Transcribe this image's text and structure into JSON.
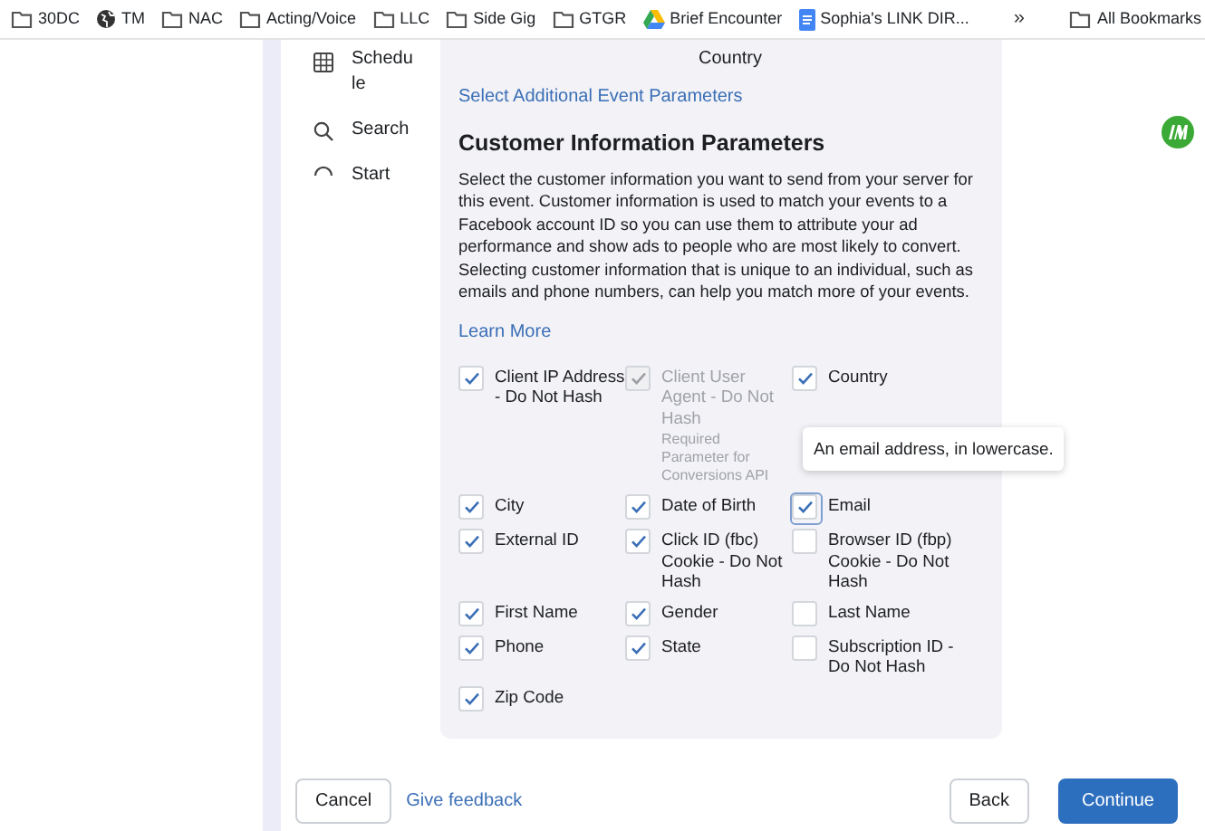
{
  "bookmarks": [
    {
      "label": "30DC",
      "kind": "folder"
    },
    {
      "label": "TM",
      "kind": "site"
    },
    {
      "label": "NAC",
      "kind": "folder"
    },
    {
      "label": "Acting/Voice",
      "kind": "folder"
    },
    {
      "label": "LLC",
      "kind": "folder"
    },
    {
      "label": "Side Gig",
      "kind": "folder"
    },
    {
      "label": "GTGR",
      "kind": "folder"
    },
    {
      "label": "Brief Encounter",
      "kind": "drive"
    },
    {
      "label": "Sophia's LINK DIR...",
      "kind": "doc"
    }
  ],
  "bookmarks_overflow": "»",
  "all_bookmarks": "All Bookmarks",
  "sidebar": {
    "items": [
      {
        "label": "Schedule"
      },
      {
        "label": "Search"
      },
      {
        "label": "Start"
      }
    ]
  },
  "previous_item": "Country",
  "additional_link": "Select Additional Event Parameters",
  "section": {
    "title": "Customer Information Parameters",
    "description": "Select the customer information you want to send from your server for this event. Customer information is used to match your events to a Facebook account ID so you can use them to attribute your ad performance and show ads to people who are most likely to convert. Selecting customer information that is unique to an individual, such as emails and phone numbers, can help you match more of your events.",
    "learn_more": "Learn More",
    "parameters": [
      {
        "label": "Client IP Address - Do Not Hash",
        "checked": true,
        "disabled": false
      },
      {
        "label": "Client User Agent - Do Not Hash",
        "note": "Required Parameter for Conversions API",
        "checked": true,
        "disabled": true
      },
      {
        "label": "Country",
        "checked": true,
        "disabled": false
      },
      {
        "label": "City",
        "checked": true,
        "disabled": false
      },
      {
        "label": "Date of Birth",
        "checked": true,
        "disabled": false
      },
      {
        "label": "Email",
        "checked": true,
        "disabled": false,
        "focused": true
      },
      {
        "label": "External ID",
        "checked": true,
        "disabled": false
      },
      {
        "label": "Click ID (fbc) Cookie - Do Not Hash",
        "checked": true,
        "disabled": false
      },
      {
        "label": "Browser ID (fbp) Cookie - Do Not Hash",
        "checked": false,
        "disabled": false
      },
      {
        "label": "First Name",
        "checked": true,
        "disabled": false
      },
      {
        "label": "Gender",
        "checked": true,
        "disabled": false
      },
      {
        "label": "Last Name",
        "checked": false,
        "disabled": false
      },
      {
        "label": "Phone",
        "checked": true,
        "disabled": false
      },
      {
        "label": "State",
        "checked": true,
        "disabled": false
      },
      {
        "label": "Subscription ID - Do Not Hash",
        "checked": false,
        "disabled": false
      },
      {
        "label": "Zip Code",
        "checked": true,
        "disabled": false
      }
    ],
    "tooltip": "An email address, in lowercase."
  },
  "footer": {
    "cancel": "Cancel",
    "feedback": "Give feedback",
    "back": "Back",
    "continue": "Continue"
  }
}
